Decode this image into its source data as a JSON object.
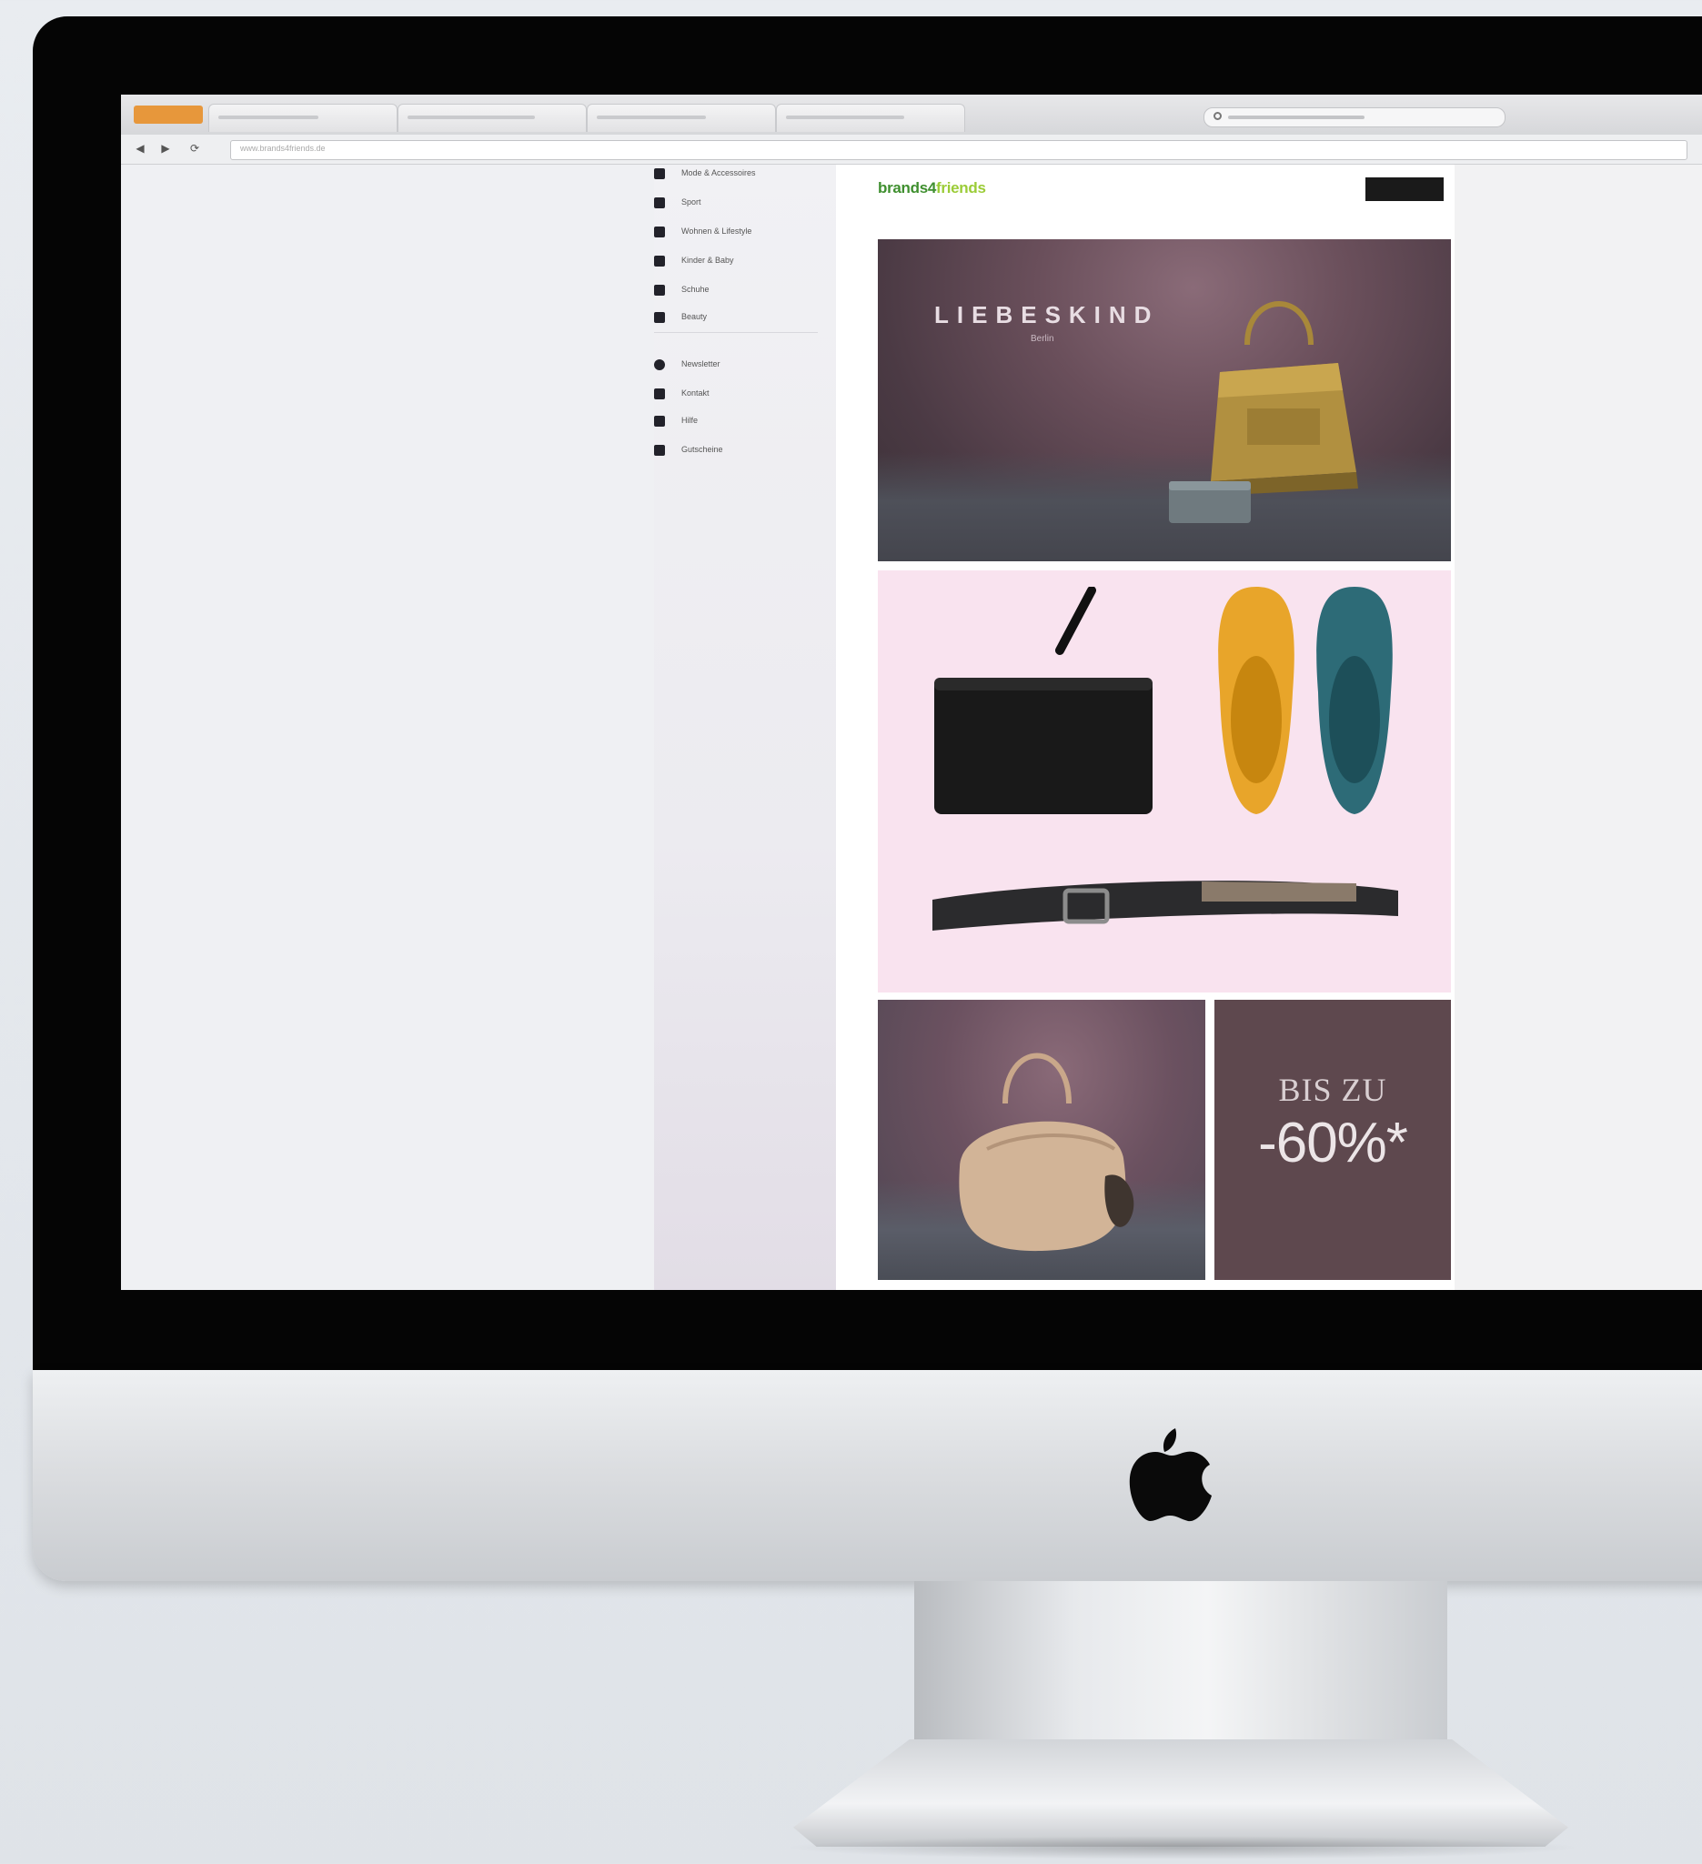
{
  "browser": {
    "url": "www.brands4friends.de",
    "search_placeholder": "",
    "nav": {
      "back": "◀",
      "forward": "▶",
      "reload": "⟳"
    }
  },
  "sidebar": {
    "items": [
      {
        "label": "Mode & Accessoires",
        "icon": "category-icon"
      },
      {
        "label": "Sport",
        "icon": "sport-icon"
      },
      {
        "label": "Wohnen & Lifestyle",
        "icon": "home-icon"
      },
      {
        "label": "Kinder & Baby",
        "icon": "kids-icon"
      },
      {
        "label": "Schuhe",
        "icon": "shoe-icon"
      },
      {
        "label": "Beauty",
        "icon": "beauty-icon"
      },
      {
        "label": "Newsletter",
        "icon": "mail-icon"
      },
      {
        "label": "Kontakt",
        "icon": "contact-icon"
      },
      {
        "label": "Hilfe",
        "icon": "help-icon"
      },
      {
        "label": "Gutscheine",
        "icon": "voucher-icon"
      }
    ]
  },
  "header": {
    "logo_part_1": "brands4",
    "logo_part_2": "friends",
    "link": "",
    "button": ""
  },
  "hero": {
    "brand": "LIEBESKIND",
    "subtitle": "Berlin"
  },
  "sale": {
    "line1": "BIS ZU",
    "line2": "-60%*",
    "cta": ""
  },
  "colors": {
    "logo_green": "#3f8f2f",
    "logo_lime": "#9bcc37",
    "hero_bg": "#5a4350",
    "products_bg": "#f9e3ef",
    "sale_bg": "#5e484e"
  }
}
